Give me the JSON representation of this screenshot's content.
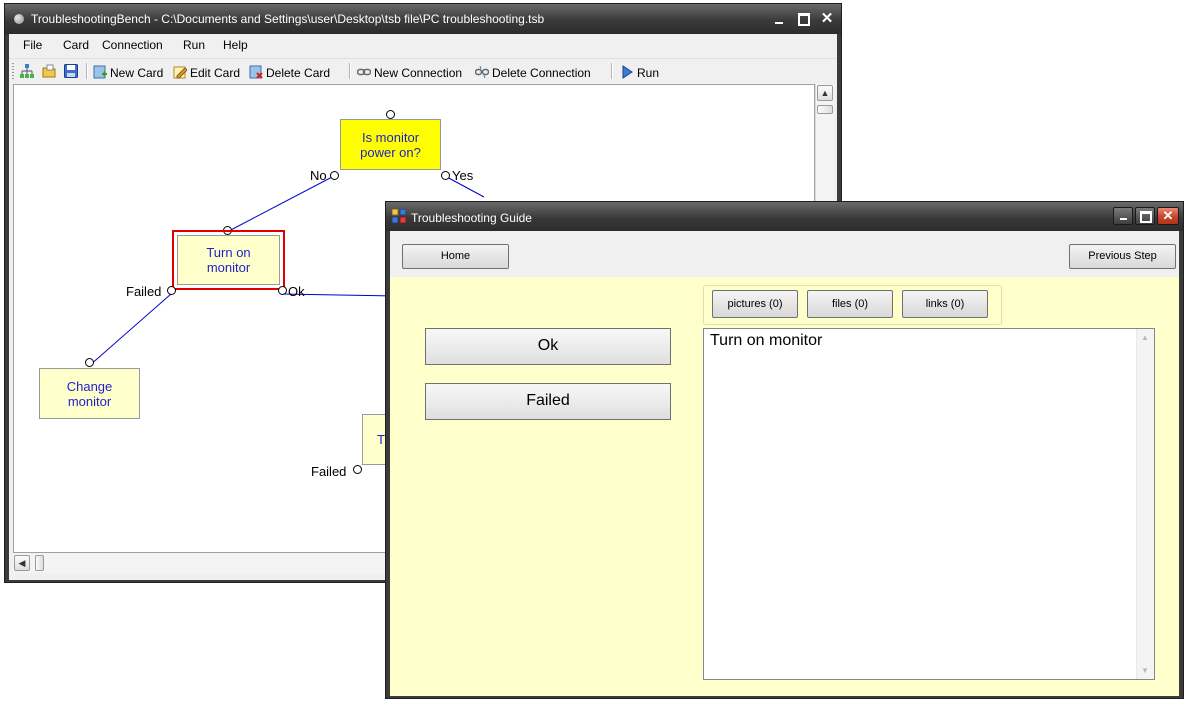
{
  "bench": {
    "title": "TroubleshootingBench - C:\\Documents and Settings\\user\\Desktop\\tsb file\\PC troubleshooting.tsb",
    "window_controls": {
      "minimize": "_",
      "maximize": "□",
      "close": "✕"
    },
    "menu": [
      "File",
      "Card",
      "Connection",
      "Run",
      "Help"
    ],
    "toolbar": {
      "new_card": "New Card",
      "edit_card": "Edit Card",
      "delete_card": "Delete Card",
      "new_connection": "New Connection",
      "delete_connection": "Delete Connection",
      "run": "Run"
    },
    "cards": {
      "root": "Is monitor power on?",
      "turn_on": "Turn on monitor",
      "change": "Change monitor",
      "partial": "T"
    },
    "edges": {
      "no": "No",
      "yes": "Yes",
      "failed_1": "Failed",
      "ok": "Ok",
      "failed_2": "Failed"
    },
    "colors": {
      "root_card": "#ffff00",
      "card": "#ffffcc",
      "selection": "#e00000",
      "edge": "#0000cc"
    }
  },
  "guide": {
    "title": "Troubleshooting Guide",
    "home_button": "Home",
    "previous_button": "Previous Step",
    "attachments": {
      "pictures": "pictures (0)",
      "files": "files (0)",
      "links": "links (0)"
    },
    "answers": [
      "Ok",
      "Failed"
    ],
    "detail_text": "Turn on monitor",
    "colors": {
      "background": "#ffffcc",
      "close_button": "#c9452a"
    }
  }
}
